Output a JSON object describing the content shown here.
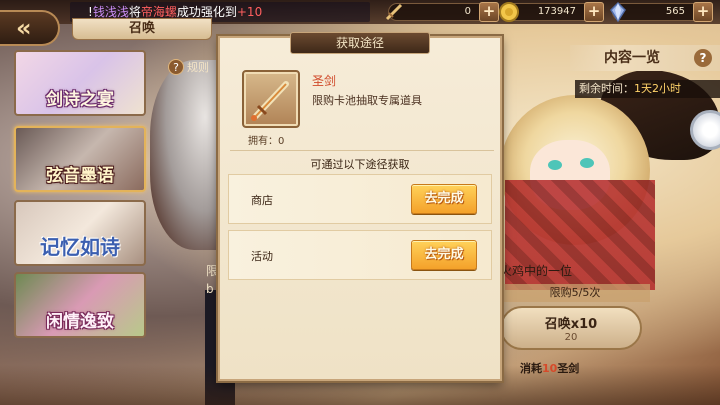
{
  "hud": {
    "marquee": {
      "prefix": "!",
      "player": "钱浅浅",
      "mid": "将",
      "item": "帝海螺",
      "action": "成功强化到",
      "level": "+10"
    },
    "resources": [
      {
        "icon": "sword-icon",
        "value": "0"
      },
      {
        "icon": "gold-coin-icon",
        "value": "173947"
      },
      {
        "icon": "crystal-icon",
        "value": "565"
      }
    ],
    "add_symbol": "+"
  },
  "back_symbol": "«",
  "summon_tab": "召唤",
  "rules_label": "规则",
  "rules_q": "?",
  "banners": [
    {
      "label": "剑诗之宴"
    },
    {
      "label": "弦音墨语"
    },
    {
      "label": "记忆如诗"
    },
    {
      "label": "闲情逸致"
    }
  ],
  "right_panel": {
    "content_list": "内容一览",
    "content_q": "?",
    "remaining_label": "剩余时间：",
    "remaining_value": "1天2小时",
    "desc_left_1": "限",
    "desc_left_2": "b",
    "desc_right": "火鸡中的一位",
    "limit": "限购5/5次",
    "summon_button": "召唤x10",
    "summon_sub": "20",
    "cost_prefix": "消耗",
    "cost_amount": "10",
    "cost_item": "圣剑"
  },
  "modal": {
    "title": "获取途径",
    "item_name": "圣剑",
    "item_desc": "限购卡池抽取专属道具",
    "owned_label": "拥有：0",
    "via_label": "可通过以下途径获取",
    "routes": [
      {
        "name": "商店",
        "button": "去完成"
      },
      {
        "name": "活动",
        "button": "去完成"
      }
    ]
  },
  "colors": {
    "go_button": "#f4a12a",
    "item_name": "#d04a2a",
    "dialog_bg": "#f6ecd8"
  }
}
